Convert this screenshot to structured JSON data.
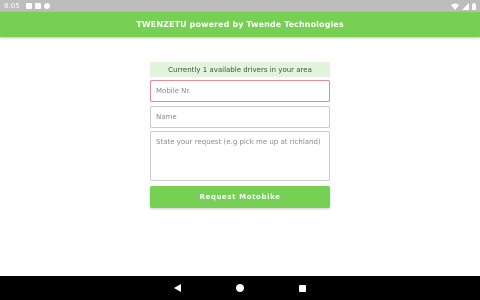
{
  "status_bar": {
    "time": "8:05",
    "left_icons": [
      "notification-icon",
      "notification-icon",
      "notification-icon"
    ],
    "right_icons": [
      "wifi-icon",
      "signal-icon",
      "battery-icon"
    ]
  },
  "app_bar": {
    "title": "TWENZETU powered by Twende Technologies",
    "color": "#76d054"
  },
  "form": {
    "availability_text": "Currently 1 available drivers in your area",
    "mobile_placeholder": "Mobile Nr.",
    "name_placeholder": "Name",
    "request_placeholder": "State your request (e.g pick me up at richland)",
    "submit_label": "Request Motobike"
  },
  "nav_bar": {
    "icons": [
      "back-icon",
      "home-icon",
      "recents-icon"
    ]
  }
}
